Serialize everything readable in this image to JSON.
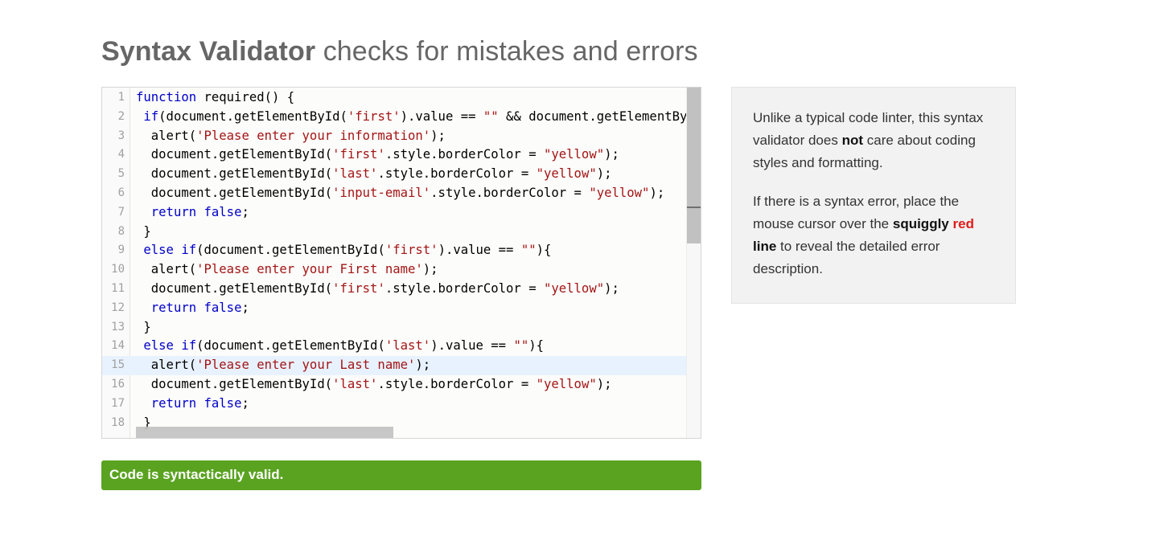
{
  "header": {
    "title_bold": "Syntax Validator",
    "title_rest": " checks for mistakes and errors"
  },
  "editor": {
    "lines": [
      {
        "n": "1",
        "code": "function required() {"
      },
      {
        "n": "2",
        "code": " if(document.getElementById('first').value == \"\" && document.getElementBy"
      },
      {
        "n": "3",
        "code": "  alert('Please enter your information');"
      },
      {
        "n": "4",
        "code": "  document.getElementById('first'.style.borderColor = \"yellow\");"
      },
      {
        "n": "5",
        "code": "  document.getElementById('last'.style.borderColor = \"yellow\");"
      },
      {
        "n": "6",
        "code": "  document.getElementById('input-email'.style.borderColor = \"yellow\");"
      },
      {
        "n": "7",
        "code": "  return false;"
      },
      {
        "n": "8",
        "code": " }"
      },
      {
        "n": "9",
        "code": " else if(document.getElementById('first').value == \"\"){"
      },
      {
        "n": "10",
        "code": "  alert('Please enter your First name');"
      },
      {
        "n": "11",
        "code": "  document.getElementById('first'.style.borderColor = \"yellow\");"
      },
      {
        "n": "12",
        "code": "  return false;"
      },
      {
        "n": "13",
        "code": " }"
      },
      {
        "n": "14",
        "code": " else if(document.getElementById('last').value == \"\"){"
      },
      {
        "n": "15",
        "code": "  alert('Please enter your Last name');"
      },
      {
        "n": "16",
        "code": "  document.getElementById('last'.style.borderColor = \"yellow\");"
      },
      {
        "n": "17",
        "code": "  return false;"
      },
      {
        "n": "18",
        "code": " }"
      }
    ],
    "active_line": "15"
  },
  "status": {
    "message": "Code is syntactically valid.",
    "color": "#5aa321"
  },
  "info": {
    "p1_a": "Unlike a typical code linter, this syntax validator does ",
    "p1_bold": "not",
    "p1_b": " care about coding styles and formatting.",
    "p2_a": "If there is a syntax error, place the mouse cursor over the ",
    "p2_bold1": "squiggly",
    "p2_red": "red",
    "p2_bold2": "line",
    "p2_b": " to reveal the detailed error description."
  }
}
